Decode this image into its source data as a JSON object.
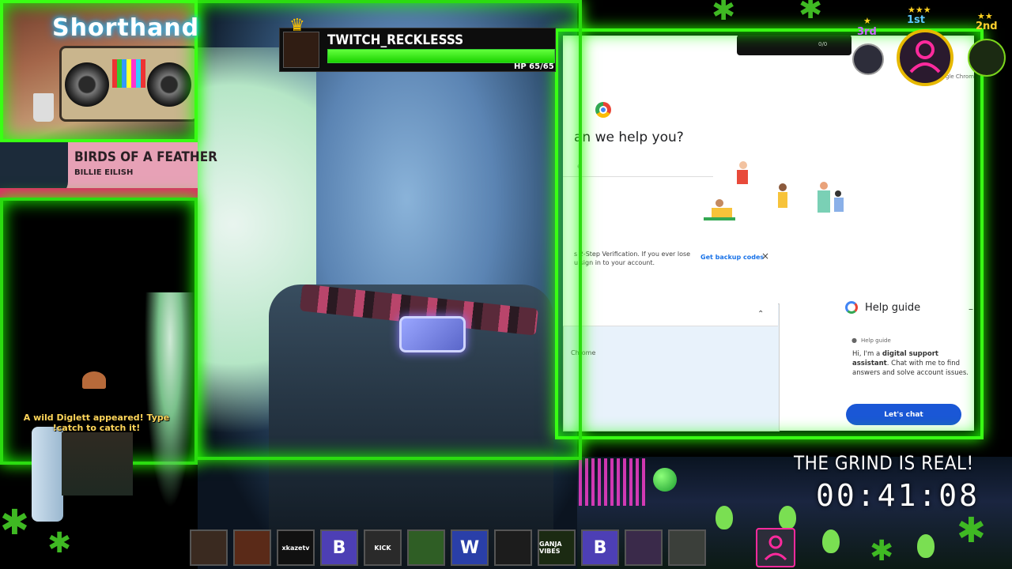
{
  "brand": {
    "title": "Shorthand"
  },
  "now_playing": {
    "title": "BIRDS OF A FEATHER",
    "artist": "BILLIE EILISH"
  },
  "streamer": {
    "name": "TWITCH_RECKLESSS",
    "hp_text": "HP 65/65",
    "hp_fraction": 1.0
  },
  "browser": {
    "help_question": "an we help you?",
    "search_placeholder": "e",
    "notice_text": "s 2-Step Verification. If you ever lose u sign in to your account.",
    "backup_link": "Get backup codes",
    "close_glyph": "×",
    "accordion_chevron": "⌃",
    "accordion_text": "Chrome",
    "chrome_label": "gle Chrom",
    "mini_count": "0/0",
    "help_guide": {
      "title": "Help guide",
      "minimize": "–",
      "sub": "Help guide",
      "body_prefix": "Hi, I'm a ",
      "body_bold": "digital support assistant",
      "body_suffix": ". Chat with me to find answers and solve account issues.",
      "chat_button": "Let's chat"
    }
  },
  "leaderboard": [
    {
      "rank": "1st",
      "stars": "★★★"
    },
    {
      "rank": "2nd",
      "stars": "★★"
    },
    {
      "rank": "3rd",
      "stars": "★"
    }
  ],
  "digimon_alert": "A wild Diglett appeared! Type !catch to catch it!",
  "timer": {
    "caption": "THE GRIND IS REAL!",
    "value": "00:41:08"
  },
  "viewers": [
    {
      "label": "",
      "color": "#3a2a20"
    },
    {
      "label": "",
      "color": "#5a2a18"
    },
    {
      "label": "xkazetv",
      "color": "#111111"
    },
    {
      "label": "B",
      "color": "#4d3fb5"
    },
    {
      "label": "KICK",
      "color": "#2a2a2a"
    },
    {
      "label": "",
      "color": "#2f5e25"
    },
    {
      "label": "W",
      "color": "#2a3fa8"
    },
    {
      "label": "",
      "color": "#1c1c1c"
    },
    {
      "label": "GANJA VIBES",
      "color": "#1b2a12"
    },
    {
      "label": "B",
      "color": "#4d3fb5"
    },
    {
      "label": "",
      "color": "#3a2a4a"
    },
    {
      "label": "",
      "color": "#3b3f3a"
    }
  ],
  "colors": {
    "accent_green": "#39ff14",
    "hp_green": "#3cff20",
    "pink": "#e6276a",
    "google_blue": "#1a57d6"
  }
}
